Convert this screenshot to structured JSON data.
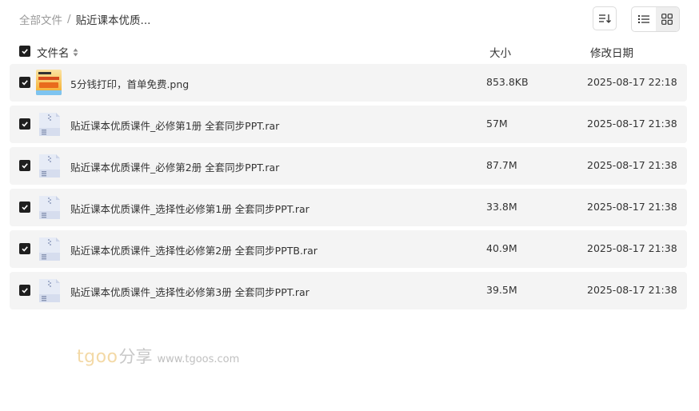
{
  "breadcrumb": {
    "root": "全部文件",
    "separator": "/",
    "current": "贴近课本优质..."
  },
  "toolbar": {
    "sort_icon": "sort-icon",
    "list_view_icon": "list-view-icon",
    "grid_view_icon": "grid-view-icon",
    "active_view": "list"
  },
  "table": {
    "headers": {
      "name": "文件名",
      "size": "大小",
      "date": "修改日期"
    },
    "rows": [
      {
        "name": "5分钱打印，首单免费.png",
        "size": "853.8KB",
        "date": "2025-08-17 22:18",
        "type": "image",
        "checked": true
      },
      {
        "name": "贴近课本优质课件_必修第1册 全套同步PPT.rar",
        "size": "57M",
        "date": "2025-08-17 21:38",
        "type": "archive",
        "checked": true
      },
      {
        "name": "贴近课本优质课件_必修第2册 全套同步PPT.rar",
        "size": "87.7M",
        "date": "2025-08-17 21:38",
        "type": "archive",
        "checked": true
      },
      {
        "name": "贴近课本优质课件_选择性必修第1册 全套同步PPT.rar",
        "size": "33.8M",
        "date": "2025-08-17 21:38",
        "type": "archive",
        "checked": true
      },
      {
        "name": "贴近课本优质课件_选择性必修第2册 全套同步PPTB.rar",
        "size": "40.9M",
        "date": "2025-08-17 21:38",
        "type": "archive",
        "checked": true
      },
      {
        "name": "贴近课本优质课件_选择性必修第3册 全套同步PPT.rar",
        "size": "39.5M",
        "date": "2025-08-17 21:38",
        "type": "archive",
        "checked": true
      }
    ]
  },
  "watermark": {
    "brand": "tgoo",
    "share": "分享",
    "url": "www.tgoos.com"
  }
}
